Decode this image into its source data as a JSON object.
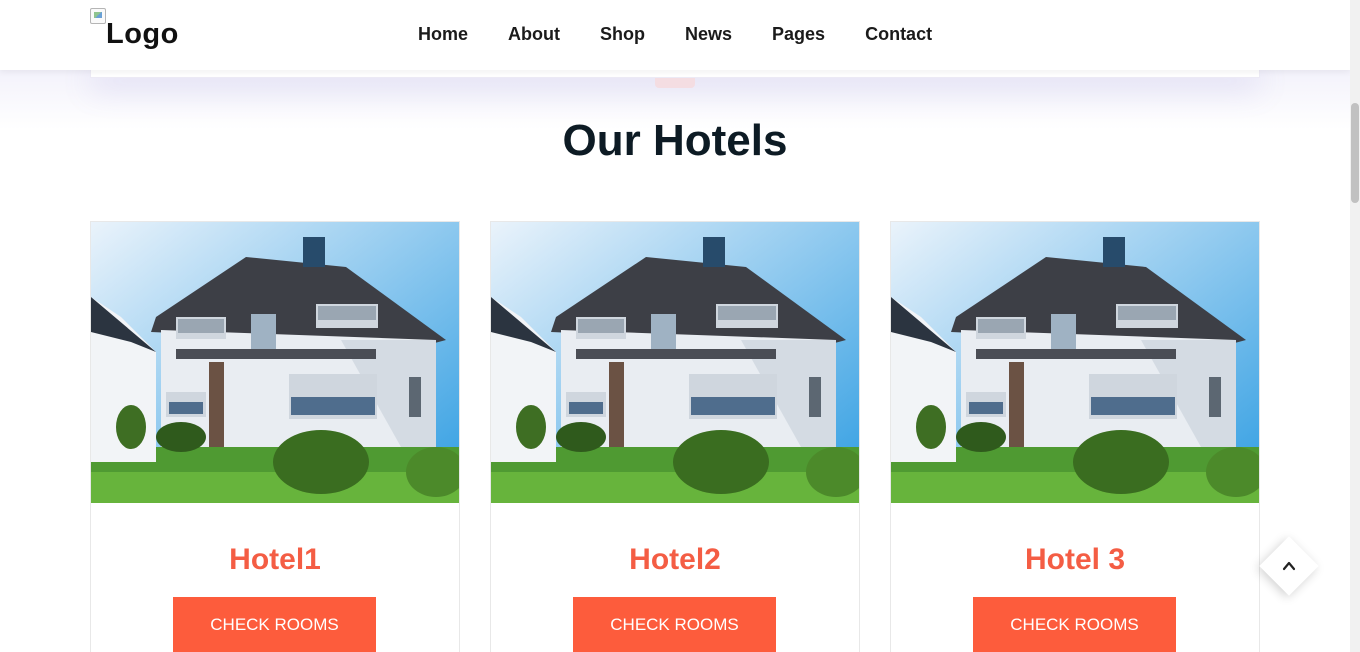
{
  "header": {
    "logo_text": "Logo",
    "nav": [
      "Home",
      "About",
      "Shop",
      "News",
      "Pages",
      "Contact"
    ]
  },
  "section": {
    "title": "Our Hotels"
  },
  "hotels": [
    {
      "name": "Hotel1",
      "button": "CHECK ROOMS"
    },
    {
      "name": "Hotel2",
      "button": "CHECK ROOMS"
    },
    {
      "name": "Hotel 3",
      "button": "CHECK ROOMS"
    }
  ],
  "icons": {
    "back_to_top": "chevron-up-icon",
    "logo": "broken-image-icon"
  },
  "colors": {
    "accent": "#fd5c3c",
    "title": "#0d1b24",
    "hotel_name": "#f45d44"
  }
}
